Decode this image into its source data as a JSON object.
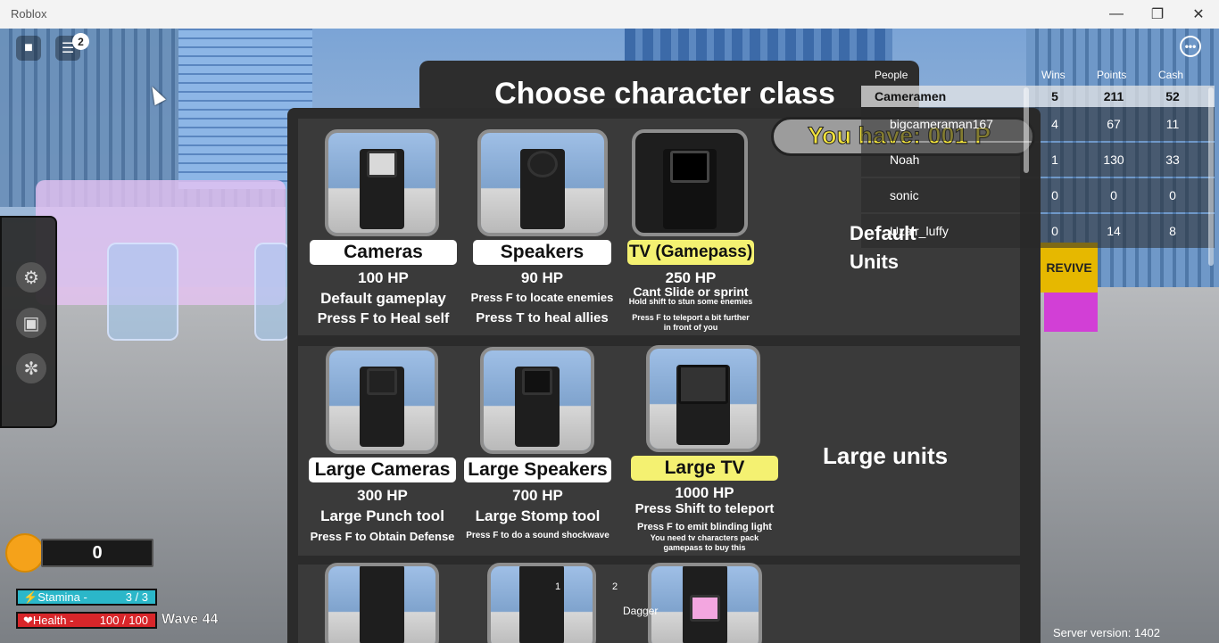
{
  "window": {
    "title": "Roblox"
  },
  "topbar": {
    "notification_count": "2"
  },
  "menu": {
    "title": "Choose character class"
  },
  "currency": {
    "you_have": "You have: 001 P"
  },
  "leaderboard": {
    "headers": [
      "People",
      "Wins",
      "Points",
      "Cash"
    ],
    "rows": [
      {
        "name": "Cameramen",
        "wins": "5",
        "points": "211",
        "cash": "52"
      },
      {
        "name": "bigcameraman167",
        "wins": "4",
        "points": "67",
        "cash": "11"
      },
      {
        "name": "Noah",
        "wins": "1",
        "points": "130",
        "cash": "33"
      },
      {
        "name": "sonic",
        "wins": "0",
        "points": "0",
        "cash": "0"
      },
      {
        "name": "Uzair_luffy",
        "wins": "0",
        "points": "14",
        "cash": "8"
      }
    ]
  },
  "sections": {
    "default_units": "Default\nUnits",
    "large_units": "Large units"
  },
  "classes": [
    {
      "name": "Cameras",
      "hp": "100 HP",
      "line1": "Default gameplay",
      "line2": "Press F to Heal self"
    },
    {
      "name": "Speakers",
      "hp": "90 HP",
      "line1": "Press F to locate enemies",
      "line2": "Press T to heal allies"
    },
    {
      "name": "TV (Gamepass)",
      "hp": "250 HP",
      "line1": "Cant Slide or sprint",
      "line2": "Hold shift to stun some enemies",
      "line3": "Press F to teleport a bit further in front of you"
    },
    {
      "name": "Large Cameras",
      "hp": "300 HP",
      "line1": "Large Punch tool",
      "line2": "Press F to Obtain Defense"
    },
    {
      "name": "Large Speakers",
      "hp": "700 HP",
      "line1": "Large Stomp tool",
      "line2": "Press F to do a sound shockwave"
    },
    {
      "name": "Large TV",
      "hp": "1000  HP",
      "line1": "Press Shift to teleport",
      "line2": "Press F to emit blinding light",
      "line3": "You need tv characters pack gamepass to buy this"
    }
  ],
  "hud": {
    "coins": "0",
    "stamina_label": "Stamina -",
    "stamina_value": "3 / 3",
    "stamina_fraction": 1.0,
    "health_label": "Health -",
    "health_value": "100 / 100",
    "health_fraction": 1.0,
    "wave": "Wave 44",
    "hotbar_1": "1",
    "hotbar_2": "2",
    "hotbar_item": "Dagger",
    "server_version": "Server version: 1402"
  },
  "colors": {
    "stamina": "#2bb7c9",
    "health": "#d8262a",
    "highlight": "#f4f171"
  }
}
